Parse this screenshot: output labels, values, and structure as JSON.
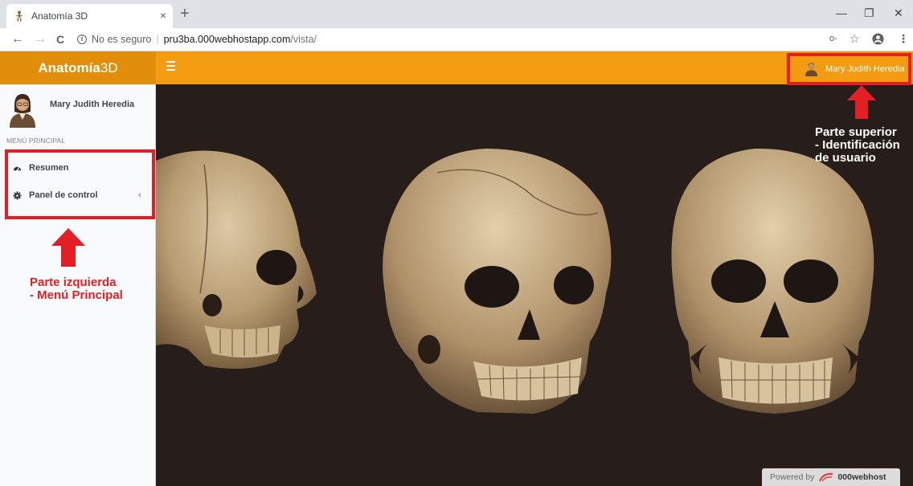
{
  "browser": {
    "tab_title": "Anatomía 3D",
    "tab_close": "×",
    "new_tab": "+",
    "window_minimize": "—",
    "window_restore": "❐",
    "window_close": "✕",
    "back": "←",
    "forward": "→",
    "reload": "C",
    "security_text": "No es seguro",
    "url_host": "pru3ba.000webhostapp.com",
    "url_path": "/vista/",
    "key_icon": "o‑",
    "star_icon": "☆",
    "menu_dots": "⋮"
  },
  "header": {
    "logo_bold": "Anatomía",
    "logo_light": "3D",
    "user_name": "Mary Judith Heredia",
    "bg_color": "#f39c12"
  },
  "sidebar": {
    "user_name": "Mary Judith Heredia",
    "menu_header": "MENÚ PRINCIPAL",
    "items": [
      {
        "label": "Resumen",
        "icon": "dashboard-icon"
      },
      {
        "label": "Panel de control",
        "icon": "gear-icon"
      }
    ],
    "chevron": "‹"
  },
  "content": {
    "image": "three-human-skulls-on-dark-background",
    "footer_prefix": "Powered by",
    "footer_brand": "000webhost"
  },
  "annotations": {
    "top_label_line1": "Parte superior",
    "top_label_line2": "- Identificación",
    "top_label_line3": "de usuario",
    "left_label_line1": "Parte izquierda",
    "left_label_line2": "- Menú Principal",
    "color": "#e31e24"
  }
}
